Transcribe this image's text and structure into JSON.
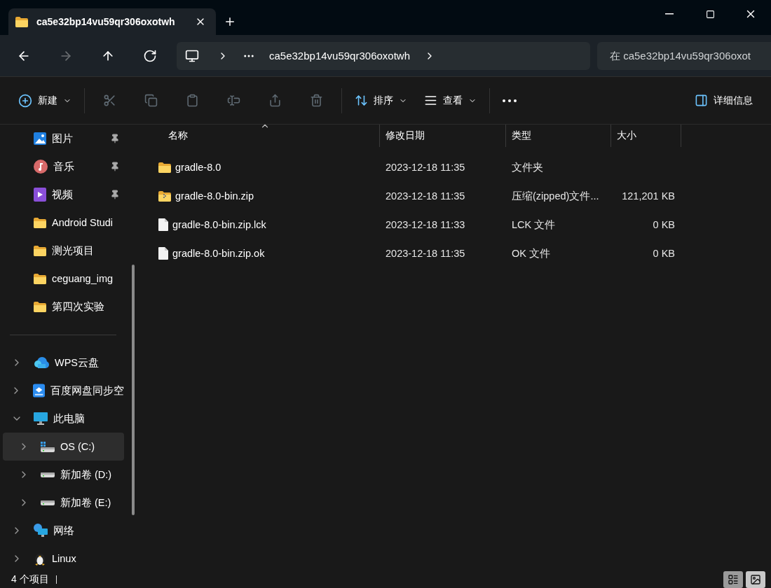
{
  "tabs": [
    {
      "title": "ca5e32bp14vu59qr306oxotwh",
      "selected": true
    }
  ],
  "nav": [
    {
      "kind": "back",
      "disabled": false
    },
    {
      "kind": "forward",
      "disabled": true
    },
    {
      "kind": "up",
      "disabled": false
    },
    {
      "kind": "refresh",
      "disabled": false
    }
  ],
  "address": {
    "path": "ca5e32bp14vu59qr306oxotwh"
  },
  "search": {
    "placeholder": "在 ca5e32bp14vu59qr306oxot"
  },
  "toolbar": {
    "new_label": "新建",
    "actions": [
      {
        "kind": "cut",
        "disabled": true
      },
      {
        "kind": "copy",
        "disabled": true
      },
      {
        "kind": "paste",
        "disabled": true
      },
      {
        "kind": "rename",
        "disabled": true
      },
      {
        "kind": "share",
        "disabled": true
      },
      {
        "kind": "delete",
        "disabled": true
      }
    ],
    "sort_label": "排序",
    "view_label": "查看",
    "details_label": "详细信息"
  },
  "sidebar": {
    "quick_access": [
      {
        "label": "图片",
        "kind": "pictures",
        "pinned": true
      },
      {
        "label": "音乐",
        "kind": "music",
        "pinned": true
      },
      {
        "label": "视频",
        "kind": "videos",
        "pinned": true
      },
      {
        "label": "Android Studi",
        "kind": "folder",
        "pinned": false
      },
      {
        "label": "测光项目",
        "kind": "folder",
        "pinned": false
      },
      {
        "label": "ceguang_img",
        "kind": "folder",
        "pinned": false
      },
      {
        "label": "第四次实验",
        "kind": "folder",
        "pinned": false
      }
    ],
    "tree": [
      {
        "label": "WPS云盘",
        "kind": "cloud",
        "expanded": false,
        "selected": false
      },
      {
        "label": "百度网盘同步空",
        "kind": "baidu",
        "expanded": false,
        "selected": false
      },
      {
        "label": "此电脑",
        "kind": "pc",
        "expanded": true,
        "selected": false,
        "children": [
          {
            "label": "OS (C:)",
            "kind": "os-drive",
            "expanded": false,
            "selected": true
          },
          {
            "label": "新加卷 (D:)",
            "kind": "drive",
            "expanded": false,
            "selected": false
          },
          {
            "label": "新加卷 (E:)",
            "kind": "drive",
            "expanded": false,
            "selected": false
          }
        ]
      },
      {
        "label": "网络",
        "kind": "network",
        "expanded": false,
        "selected": false
      },
      {
        "label": "Linux",
        "kind": "linux",
        "expanded": false,
        "selected": false
      }
    ]
  },
  "table": {
    "columns": [
      {
        "label": "名称",
        "sorted": true
      },
      {
        "label": "修改日期",
        "sorted": false
      },
      {
        "label": "类型",
        "sorted": false
      },
      {
        "label": "大小",
        "sorted": false
      }
    ],
    "rows": [
      {
        "kind": "folder",
        "name": "gradle-8.0",
        "modified": "2023-12-18 11:35",
        "type": "文件夹"
      },
      {
        "kind": "zip",
        "name": "gradle-8.0-bin.zip",
        "modified": "2023-12-18 11:35",
        "type": "压缩(zipped)文件...",
        "size": "121,201 KB"
      },
      {
        "kind": "file",
        "name": "gradle-8.0-bin.zip.lck",
        "modified": "2023-12-18 11:33",
        "type": "LCK 文件",
        "size": "0 KB"
      },
      {
        "kind": "file",
        "name": "gradle-8.0-bin.zip.ok",
        "modified": "2023-12-18 11:35",
        "type": "OK 文件",
        "size": "0 KB"
      }
    ]
  },
  "status_bar": {
    "count": "4 个项目",
    "views": [
      {
        "kind": "details",
        "selected": true
      },
      {
        "kind": "tiles",
        "selected": false
      }
    ]
  }
}
